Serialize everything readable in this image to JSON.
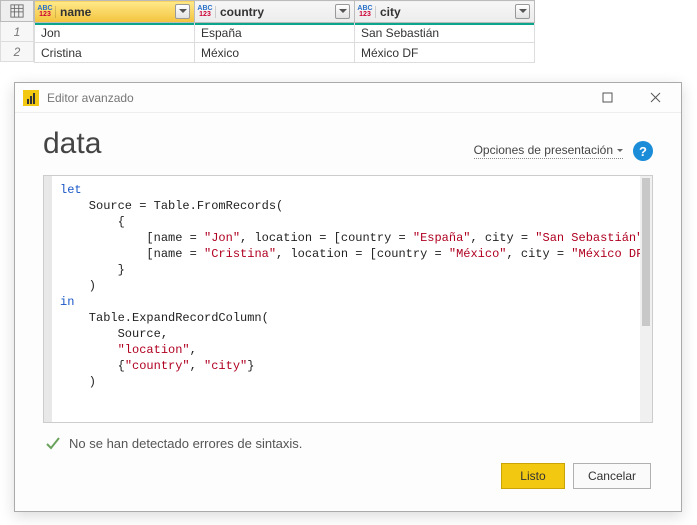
{
  "table": {
    "columns": [
      {
        "name": "name",
        "selected": true
      },
      {
        "name": "country",
        "selected": false
      },
      {
        "name": "city",
        "selected": false
      }
    ],
    "rows": [
      {
        "n": "1",
        "c0": "Jon",
        "c1": "España",
        "c2": "San Sebastián"
      },
      {
        "n": "2",
        "c0": "Cristina",
        "c1": "México",
        "c2": "México DF"
      }
    ]
  },
  "dialog": {
    "title": "Editor avanzado",
    "query_name": "data",
    "display_options_label": "Opciones de presentación",
    "status_text": "No se han detectado errores de sintaxis.",
    "btn_done": "Listo",
    "btn_cancel": "Cancelar",
    "code": {
      "l1": "let",
      "l2": "    Source = Table.FromRecords(",
      "l3": "        {",
      "l4a": "            [name = ",
      "s4a": "\"Jon\"",
      "l4b": ", location = [country = ",
      "s4b": "\"España\"",
      "l4c": ", city = ",
      "s4c": "\"San Sebastián\"",
      "l4d": "]],",
      "l5a": "            [name = ",
      "s5a": "\"Cristina\"",
      "l5b": ", location = [country = ",
      "s5b": "\"México\"",
      "l5c": ", city = ",
      "s5c": "\"México DF\"",
      "l5d": "]]",
      "l6": "        }",
      "l7": "    )",
      "l8": "in",
      "l9": "    Table.ExpandRecordColumn(",
      "l10": "        Source,",
      "l11a": "        ",
      "s11": "\"location\"",
      "l11b": ",",
      "l12a": "        {",
      "s12a": "\"country\"",
      "l12b": ", ",
      "s12b": "\"city\"",
      "l12c": "}",
      "l13": "    )"
    }
  }
}
